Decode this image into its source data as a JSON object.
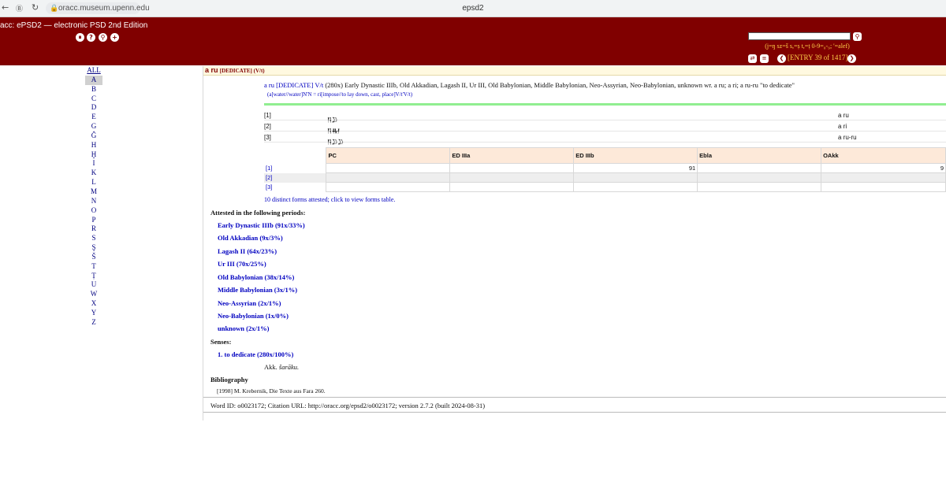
{
  "browser": {
    "url": "oracc.museum.upenn.edu",
    "tab_title": "epsd2"
  },
  "header": {
    "app_title": "acc: ePSD2 — electronic PSD 2nd Edition",
    "search_hint": "(j=ŋ sz=š s,=ṣ t,=ṭ 0-9=₀-₉; '=alef)",
    "entry_counter": "[ENTRY 39 of 1417]"
  },
  "sidebar": {
    "all_label": "ALL",
    "letters": [
      "A",
      "B",
      "C",
      "D",
      "E",
      "G",
      "Ĝ",
      "H",
      "Ḫ",
      "I",
      "K",
      "L",
      "M",
      "N",
      "O",
      "P",
      "R",
      "S",
      "Ş",
      "Š",
      "T",
      "Ṭ",
      "U",
      "W",
      "X",
      "Y",
      "Z"
    ],
    "active_letter": "A"
  },
  "entry": {
    "citation_form": "a ru",
    "guideword": "[DEDICATE] (V/t)",
    "summary_cf": "a ru",
    "summary_gw": "[DEDICATE]",
    "summary_pos": "V/t",
    "summary_rest": "(280x) Early Dynastic IIIb, Old Akkadian, Lagash II, Ur III, Old Babylonian, Middle Babylonian, Neo-Assyrian, Neo-Babylonian, unknown wr. a ru; a ri; a ru-ru \"to dedicate\"",
    "summary_sub": "(a[water//water]N'N = ri[impose//to lay down, cast, place]V/t'V/t)"
  },
  "forms": [
    {
      "num": "[1]",
      "cuneiform": "𒀀𒊒",
      "translit": "a ru"
    },
    {
      "num": "[2]",
      "cuneiform": "𒀀𒊑",
      "translit": "a ri"
    },
    {
      "num": "[3]",
      "cuneiform": "𒀀𒊒𒊒",
      "translit": "a ru-ru"
    }
  ],
  "period_table": {
    "headers": [
      "PC",
      "ED IIIa",
      "ED IIIb",
      "Ebla",
      "OAkk"
    ],
    "rows": [
      {
        "num": "[1]",
        "cells": [
          "",
          "",
          "91",
          "",
          "9"
        ]
      },
      {
        "num": "[2]",
        "cells": [
          "",
          "",
          "",
          "",
          ""
        ]
      },
      {
        "num": "[3]",
        "cells": [
          "",
          "",
          "",
          "",
          ""
        ]
      }
    ]
  },
  "forms_note": "10 distinct forms attested; click to view forms table.",
  "attested": {
    "heading": "Attested in the following periods:",
    "periods": [
      "Early Dynastic IIIb (91x/33%)",
      "Old Akkadian (9x/3%)",
      "Lagash II (64x/23%)",
      "Ur III (70x/25%)",
      "Old Babylonian (38x/14%)",
      "Middle Babylonian (3x/1%)",
      "Neo-Assyrian (2x/1%)",
      "Neo-Babylonian (1x/0%)",
      "unknown (2x/1%)"
    ]
  },
  "senses": {
    "heading": "Senses:",
    "items": [
      "1. to dedicate (280x/100%)"
    ],
    "akk_prefix": "Akk.",
    "akk_word": "šarāku."
  },
  "bibliography": {
    "heading": "Bibliography",
    "items": [
      "[1998] M. Krebernik, Die Texte aus Fara 260."
    ]
  },
  "footer": {
    "word_id": "Word ID: o0023172; Citation URL: http://oracc.org/epsd2/o0023172; version 2.7.2 (built 2024-08-31)"
  }
}
